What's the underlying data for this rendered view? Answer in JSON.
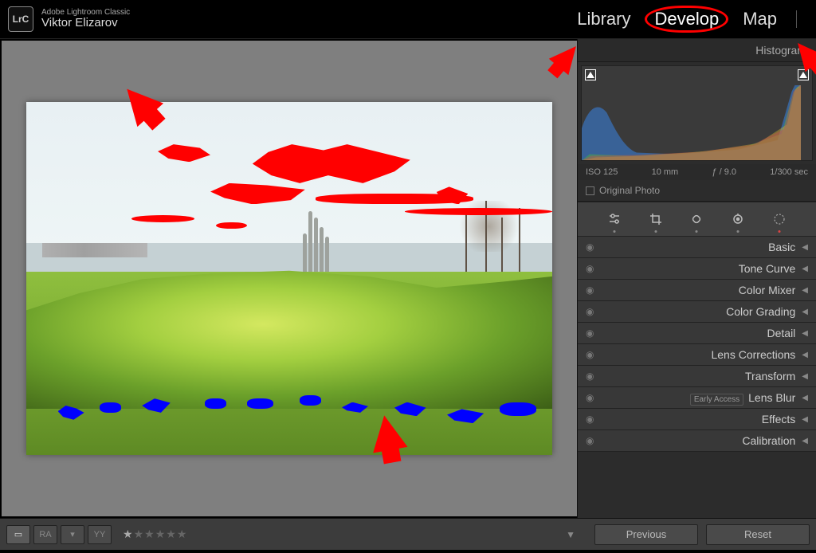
{
  "app": {
    "logo": "LrC",
    "name": "Adobe Lightroom Classic",
    "user": "Viktor Elizarov"
  },
  "modules": {
    "library": "Library",
    "develop": "Develop",
    "map": "Map",
    "active": "develop"
  },
  "histogram": {
    "title": "Histogram",
    "exif": {
      "iso": "ISO 125",
      "focal": "10 mm",
      "aperture": "ƒ / 9.0",
      "shutter": "1/300 sec"
    },
    "original_label": "Original Photo"
  },
  "tools": [
    {
      "name": "adjust",
      "dot": "#888"
    },
    {
      "name": "crop",
      "dot": "#888"
    },
    {
      "name": "heal",
      "dot": "#888"
    },
    {
      "name": "redeye",
      "dot": "#888"
    },
    {
      "name": "mask",
      "dot": "#d44"
    }
  ],
  "panels": [
    {
      "label": "Basic"
    },
    {
      "label": "Tone Curve"
    },
    {
      "label": "Color Mixer"
    },
    {
      "label": "Color Grading"
    },
    {
      "label": "Detail"
    },
    {
      "label": "Lens Corrections"
    },
    {
      "label": "Transform"
    },
    {
      "label": "Lens Blur",
      "badge": "Early Access"
    },
    {
      "label": "Effects"
    },
    {
      "label": "Calibration"
    }
  ],
  "viewmodes": [
    {
      "label": "▭",
      "active": true
    },
    {
      "label": "RA"
    },
    {
      "label": "▾"
    },
    {
      "label": "YY"
    }
  ],
  "rating": {
    "filled": 1,
    "total": 6
  },
  "footer": {
    "previous": "Previous",
    "reset": "Reset"
  }
}
